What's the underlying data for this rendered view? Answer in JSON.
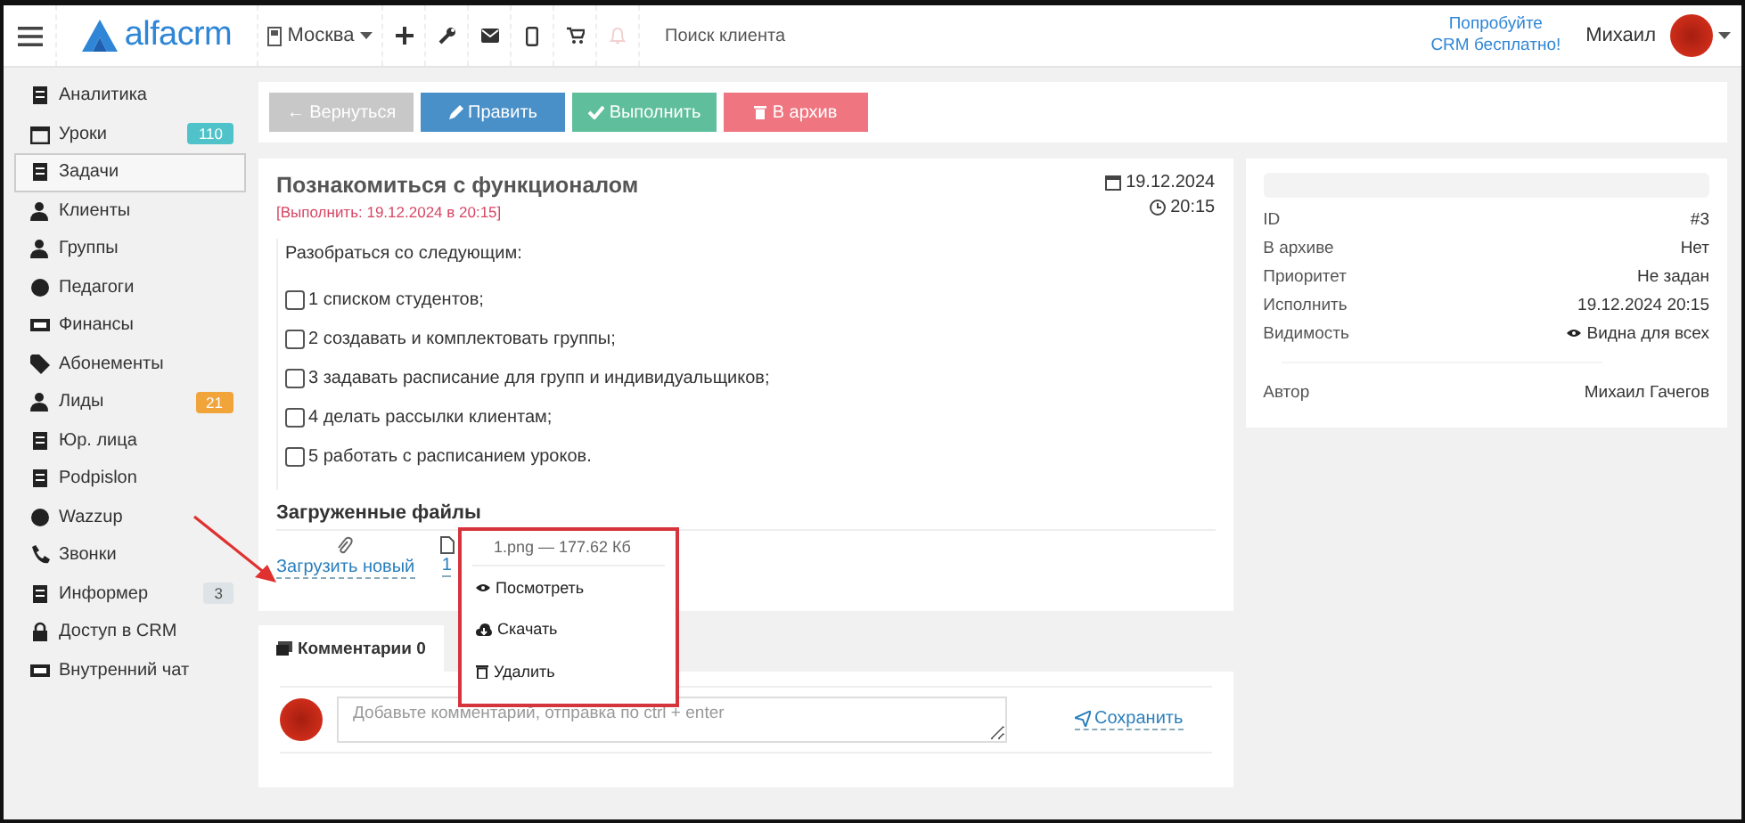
{
  "header": {
    "logo": "alfacrm",
    "city": "Москва",
    "search": {
      "placeholder": "Поиск клиента"
    },
    "promo": "Попробуйте\nCRM бесплатно!",
    "user": "Михаил"
  },
  "sidebar": {
    "items": [
      {
        "label": "Аналитика",
        "selected": false
      },
      {
        "label": "Уроки",
        "selected": false,
        "badge": "110",
        "color": "#4fc3c9"
      },
      {
        "label": "Задачи",
        "selected": true
      },
      {
        "label": "Клиенты",
        "selected": false
      },
      {
        "label": "Группы",
        "selected": false
      },
      {
        "label": "Педагоги",
        "selected": false
      },
      {
        "label": "Финансы",
        "selected": false
      },
      {
        "label": "Абонементы",
        "selected": false
      },
      {
        "label": "Лиды",
        "selected": false,
        "badge": "21",
        "color": "#f0a43a"
      },
      {
        "label": "Юр. лица",
        "selected": false
      },
      {
        "label": "Podpislon",
        "selected": false
      },
      {
        "label": "Wazzup",
        "selected": false
      },
      {
        "label": "Звонки",
        "selected": false
      },
      {
        "label": "Информер",
        "selected": false,
        "badge": "3",
        "color": "#dde3e6"
      },
      {
        "label": "Доступ в CRM",
        "selected": false
      },
      {
        "label": "Внутренний чат",
        "selected": false
      }
    ]
  },
  "toolbar": {
    "buttons": [
      {
        "label": "← Вернуться",
        "kind": "back"
      },
      {
        "label": "Править",
        "kind": "edit"
      },
      {
        "label": "Выполнить",
        "kind": "complete"
      },
      {
        "label": "В архив",
        "kind": "archive"
      }
    ]
  },
  "task": {
    "title": "Познакомиться с функционалом",
    "deadline": "[Выполнить: 19.12.2024 в 20:15]",
    "date": "19.12.2024",
    "time": "20:15",
    "intro": "Разобраться со следующим:",
    "checklist": [
      {
        "label": "1 списком студентов;",
        "checked": false
      },
      {
        "label": "2 создавать и комплектовать группы;",
        "checked": false
      },
      {
        "label": "3 задавать расписание для групп и индивидуальщиков;",
        "checked": false
      },
      {
        "label": "4 делать рассылки клиентам;",
        "checked": false
      },
      {
        "label": "5 работать с расписанием уроков.",
        "checked": false
      }
    ],
    "files": {
      "heading": "Загруженные файлы",
      "upload": "Загрузить новый",
      "file_link": "1",
      "menu": {
        "title": "1.png — 177.62 Кб",
        "items": [
          {
            "label": "Посмотреть",
            "kind": "view"
          },
          {
            "label": "Скачать",
            "kind": "download"
          },
          {
            "label": "Удалить",
            "kind": "delete"
          }
        ]
      }
    }
  },
  "details": {
    "rows": [
      {
        "label": "ID",
        "value": "#3"
      },
      {
        "label": "В архиве",
        "value": "Нет"
      },
      {
        "label": "Приоритет",
        "value": "Не задан"
      },
      {
        "label": "Исполнить",
        "value": "19.12.2024 20:15"
      },
      {
        "label": "Видимость",
        "value": "Видна для всех",
        "kind": "visibility"
      }
    ],
    "author": {
      "label": "Автор",
      "value": "Михаил Гачегов"
    }
  },
  "comments": {
    "tab": "Комментарии 0",
    "placeholder": "Добавьте комментарий, отправка по ctrl + enter",
    "save": "Сохранить"
  }
}
